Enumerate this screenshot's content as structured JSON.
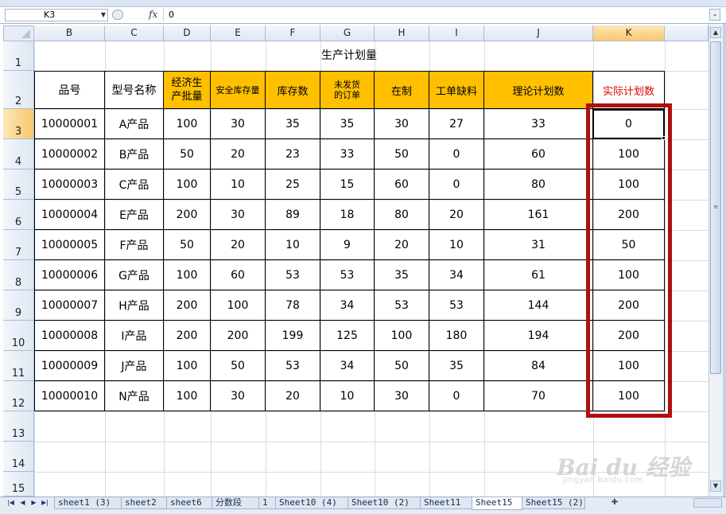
{
  "formula_bar": {
    "name_box": "K3",
    "fx_label": "fx",
    "formula": "0"
  },
  "columns": [
    "B",
    "C",
    "D",
    "E",
    "F",
    "G",
    "H",
    "I",
    "J",
    "K"
  ],
  "rows": [
    "1",
    "2",
    "3",
    "4",
    "5",
    "6",
    "7",
    "8",
    "9",
    "10",
    "11",
    "12",
    "13",
    "14",
    "15"
  ],
  "sheet_title": "生产计划量",
  "headers": {
    "part_no": "品号",
    "model": "型号名称",
    "eoq_line1": "经济生",
    "eoq_line2": "产批量",
    "safety_stock": "安全库存量",
    "inventory": "库存数",
    "unshipped_line1": "未发货",
    "unshipped_line2": "的订单",
    "in_process": "在制",
    "shortage": "工单缺料",
    "theoretical": "理论计划数",
    "actual": "实际计划数"
  },
  "table_rows": [
    [
      "10000001",
      "A产品",
      "100",
      "30",
      "35",
      "35",
      "30",
      "27",
      "33",
      "0"
    ],
    [
      "10000002",
      "B产品",
      "50",
      "20",
      "23",
      "33",
      "50",
      "0",
      "60",
      "100"
    ],
    [
      "10000003",
      "C产品",
      "100",
      "10",
      "25",
      "15",
      "60",
      "0",
      "80",
      "100"
    ],
    [
      "10000004",
      "E产品",
      "200",
      "30",
      "89",
      "18",
      "80",
      "20",
      "161",
      "200"
    ],
    [
      "10000005",
      "F产品",
      "50",
      "20",
      "10",
      "9",
      "20",
      "10",
      "31",
      "50"
    ],
    [
      "10000006",
      "G产品",
      "100",
      "60",
      "53",
      "53",
      "35",
      "34",
      "61",
      "100"
    ],
    [
      "10000007",
      "H产品",
      "200",
      "100",
      "78",
      "34",
      "53",
      "53",
      "144",
      "200"
    ],
    [
      "10000008",
      "I产品",
      "200",
      "200",
      "199",
      "125",
      "100",
      "180",
      "194",
      "200"
    ],
    [
      "10000009",
      "J产品",
      "100",
      "50",
      "53",
      "34",
      "50",
      "35",
      "84",
      "100"
    ],
    [
      "10000010",
      "N产品",
      "100",
      "30",
      "20",
      "10",
      "30",
      "0",
      "70",
      "100"
    ]
  ],
  "sheet_tabs": [
    "sheet1 (3)",
    "sheet2",
    "sheet6",
    "分数段",
    "1",
    "Sheet10 (4)",
    "Sheet10 (2)",
    "Sheet11",
    "Sheet15",
    "Sheet15 (2)"
  ],
  "active_tab": "Sheet15",
  "watermark": {
    "brand": "Bai du 经验",
    "url": "jingyan.baidu.com"
  },
  "colors": {
    "header_fill": "#ffc000",
    "actual_header_text": "#e00000",
    "highlight_box": "#b00f10"
  }
}
